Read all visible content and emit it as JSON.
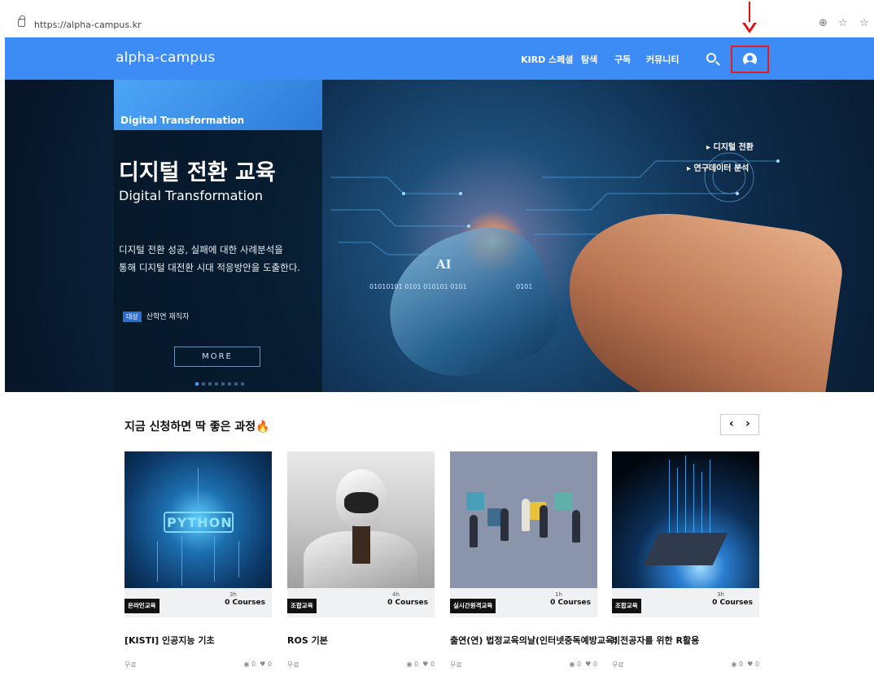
{
  "browser": {
    "url": "https://alpha-campus.kr",
    "tools": [
      "⊕",
      "☆",
      "☆"
    ]
  },
  "header": {
    "logo": "alpha-campus",
    "nav": [
      "KIRD 스페셜",
      "탐색",
      "구독",
      "커뮤니티"
    ]
  },
  "hero": {
    "tag": "Digital Transformation",
    "title": "디지털 전환 교육",
    "subtitle": "Digital Transformation",
    "desc_line1": "디지털 전환 성공, 실패에 대한 사례분석을",
    "desc_line2": "통해 디지털 대전환 시대 적응방안을 도출한다.",
    "target_badge": "대상",
    "target_text": "산학연 재직자",
    "more": "MORE",
    "links": [
      "▸ 디지털 전환",
      "▸ 연구데이터 분석"
    ],
    "ai_label": "AI",
    "binary_left": "01010101 0101 010101 0101",
    "binary_right": "0101"
  },
  "section": {
    "title": "지금 신청하면 딱 좋은 과정🔥",
    "prev": "‹",
    "next": "›"
  },
  "courses": [
    {
      "category": "온라인교육",
      "hours": "3h",
      "count": "0 Courses",
      "title": "[KISTI] 인공지능 기초",
      "price": "무료",
      "views": "0",
      "likes": "0",
      "thumb_text": "PYTHON"
    },
    {
      "category": "조합교육",
      "hours": "4h",
      "count": "0 Courses",
      "title": "ROS 기본",
      "price": "무료",
      "views": "0",
      "likes": "0"
    },
    {
      "category": "실시간원격교육",
      "hours": "1h",
      "count": "0 Courses",
      "title": "출연(연) 법정교육의날(인터넷중독예방교육)",
      "price": "무료",
      "views": "0",
      "likes": "0"
    },
    {
      "category": "조합교육",
      "hours": "3h",
      "count": "0 Courses",
      "title": "비전공자를 위한 R활용",
      "price": "무료",
      "views": "0",
      "likes": "0"
    }
  ]
}
